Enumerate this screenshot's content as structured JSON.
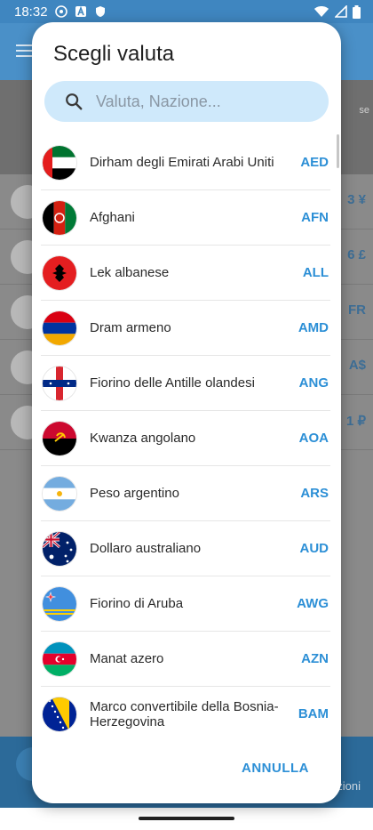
{
  "status_bar": {
    "time": "18:32",
    "icons": [
      "circle-status-icon",
      "a-badge-icon",
      "shield-icon"
    ],
    "right_icons": [
      "wifi-icon",
      "signal-icon",
      "battery-icon"
    ]
  },
  "background": {
    "hint_text": "se",
    "values": [
      "3 ¥",
      "6 £",
      "FR",
      "A$",
      "1 ₽"
    ],
    "bottom_label": "zioni"
  },
  "dialog": {
    "title": "Scegli valuta",
    "search_placeholder": "Valuta, Nazione...",
    "cancel_label": "ANNULLA",
    "currencies": [
      {
        "name": "Dirham degli Emirati Arabi Uniti",
        "code": "AED",
        "flag": "uae-flag"
      },
      {
        "name": "Afghani",
        "code": "AFN",
        "flag": "afghanistan-flag"
      },
      {
        "name": "Lek albanese",
        "code": "ALL",
        "flag": "albania-flag"
      },
      {
        "name": "Dram armeno",
        "code": "AMD",
        "flag": "armenia-flag"
      },
      {
        "name": "Fiorino delle Antille olandesi",
        "code": "ANG",
        "flag": "netherlands-antilles-flag"
      },
      {
        "name": "Kwanza angolano",
        "code": "AOA",
        "flag": "angola-flag"
      },
      {
        "name": "Peso argentino",
        "code": "ARS",
        "flag": "argentina-flag"
      },
      {
        "name": "Dollaro australiano",
        "code": "AUD",
        "flag": "australia-flag"
      },
      {
        "name": "Fiorino di Aruba",
        "code": "AWG",
        "flag": "aruba-flag"
      },
      {
        "name": "Manat azero",
        "code": "AZN",
        "flag": "azerbaijan-flag"
      },
      {
        "name": "Marco convertibile della Bosnia-Herzegovina",
        "code": "BAM",
        "flag": "bosnia-flag"
      }
    ]
  },
  "colors": {
    "accent": "#2c8fd6",
    "search_bg": "#cfe9fb",
    "appbar": "#4a90c8"
  }
}
